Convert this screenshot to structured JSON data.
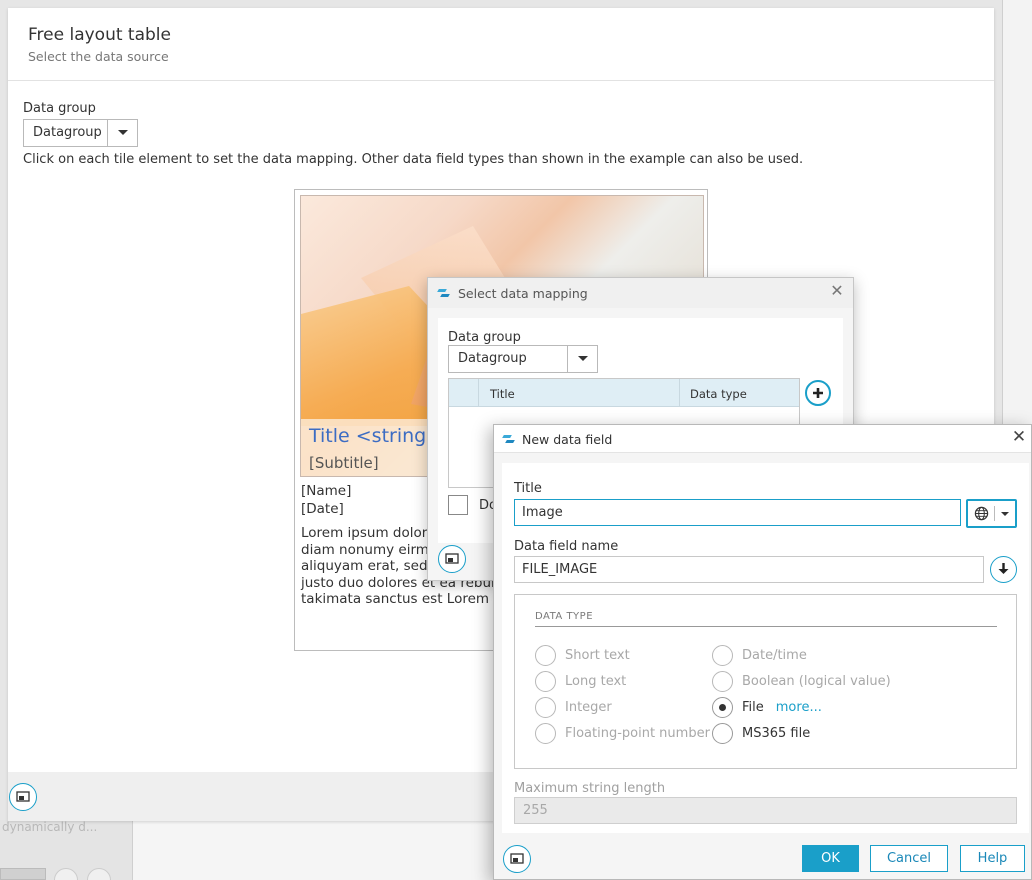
{
  "background": {
    "faded_text": "dynamically d..."
  },
  "main": {
    "title": "Free layout table",
    "subtitle": "Select the data source",
    "data_group_label": "Data group",
    "data_group_value": "Datagroup",
    "instructions": "Click on each tile element to set the data mapping. Other data field types than shown in the example can also be used.",
    "tile": {
      "title": "Title <string>",
      "subtitle": "[Subtitle]",
      "name": "[Name]",
      "date": "[Date]",
      "lorem_lines": [
        "Lorem ipsum dolor s",
        "diam nonumy eirmod",
        "aliquyam erat, sed di",
        "justo duo dolores et ea rebum.",
        "takimata sanctus est Lorem ips"
      ]
    }
  },
  "select_mapping_dialog": {
    "title": "Select data mapping",
    "data_group_label": "Data group",
    "data_group_value": "Datagroup",
    "columns": [
      "Title",
      "Data type"
    ],
    "checkbox_label": "Do"
  },
  "new_field_dialog": {
    "title": "New data field",
    "title_label": "Title",
    "title_value": "Image",
    "field_name_label": "Data field name",
    "field_name_value": "FILE_IMAGE",
    "data_type_heading": "DATA TYPE",
    "types_left": [
      "Short text",
      "Long text",
      "Integer",
      "Floating-point number"
    ],
    "types_right": [
      "Date/time",
      "Boolean (logical value)",
      "File",
      "MS365 file"
    ],
    "selected_type": "File",
    "more_link": "more...",
    "max_length_label": "Maximum string length",
    "max_length_value": "255",
    "buttons": {
      "ok": "OK",
      "cancel": "Cancel",
      "help": "Help"
    }
  },
  "colors": {
    "accent": "#1a9fc9",
    "tile_title": "#3c6cc3"
  }
}
